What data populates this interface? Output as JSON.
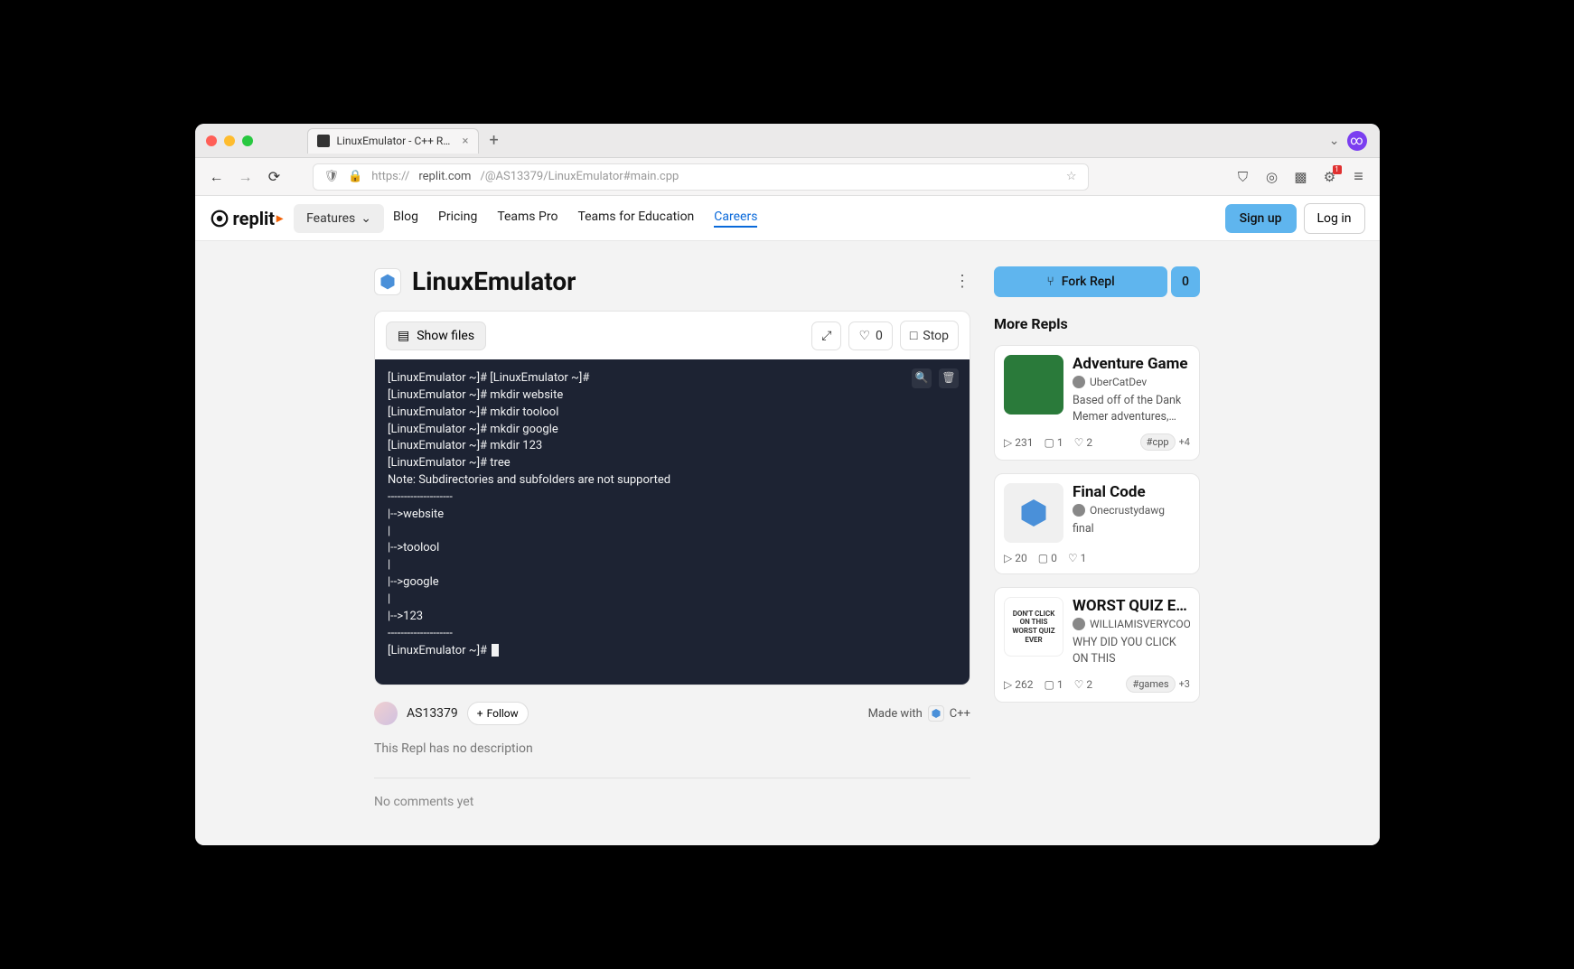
{
  "browser": {
    "tab_title": "LinuxEmulator - C++ Repl - Rep...",
    "url_prefix": "https://",
    "url_host": "replit.com",
    "url_path": "/@AS13379/LinuxEmulator#main.cpp",
    "notif_count": "1"
  },
  "header": {
    "logo": "replit",
    "features": "Features",
    "nav": [
      "Blog",
      "Pricing",
      "Teams Pro",
      "Teams for Education",
      "Careers"
    ],
    "signup": "Sign up",
    "login": "Log in"
  },
  "repl": {
    "title": "LinuxEmulator",
    "show_files": "Show files",
    "like_count": "0",
    "stop": "Stop",
    "terminal": "[LinuxEmulator ~]# [LinuxEmulator ~]#\n[LinuxEmulator ~]# mkdir website\n[LinuxEmulator ~]# mkdir toolool\n[LinuxEmulator ~]# mkdir google\n[LinuxEmulator ~]# mkdir 123\n[LinuxEmulator ~]# tree\nNote: Subdirectories and subfolders are not supported\n--------------------\n|-->website\n|\n|-->toolool\n|\n|-->google\n|\n|-->123\n--------------------\n[LinuxEmulator ~]# ",
    "author": "AS13379",
    "follow": "Follow",
    "made_with": "Made with",
    "lang": "C++",
    "description": "This Repl has no description",
    "no_comments": "No comments yet"
  },
  "side": {
    "fork_label": "Fork Repl",
    "fork_count": "0",
    "heading": "More Repls",
    "cards": [
      {
        "title": "Adventure Game",
        "author": "UberCatDev",
        "desc": "Based off of the Dank Memer adventures, this...",
        "runs": "231",
        "comments": "1",
        "likes": "2",
        "tag": "#cpp",
        "tag_more": "+4"
      },
      {
        "title": "Final Code",
        "author": "Onecrustydawg",
        "desc": "final",
        "runs": "20",
        "comments": "0",
        "likes": "1",
        "tag": "",
        "tag_more": ""
      },
      {
        "title": "WORST QUIZ EV...",
        "author": "WILLIAMISVERYCOOL...",
        "desc": "WHY DID YOU CLICK ON THIS",
        "runs": "262",
        "comments": "1",
        "likes": "2",
        "tag": "#games",
        "tag_more": "+3",
        "thumb_text": "DON'T CLICK ON THIS WORST QUIZ EVER"
      }
    ]
  }
}
